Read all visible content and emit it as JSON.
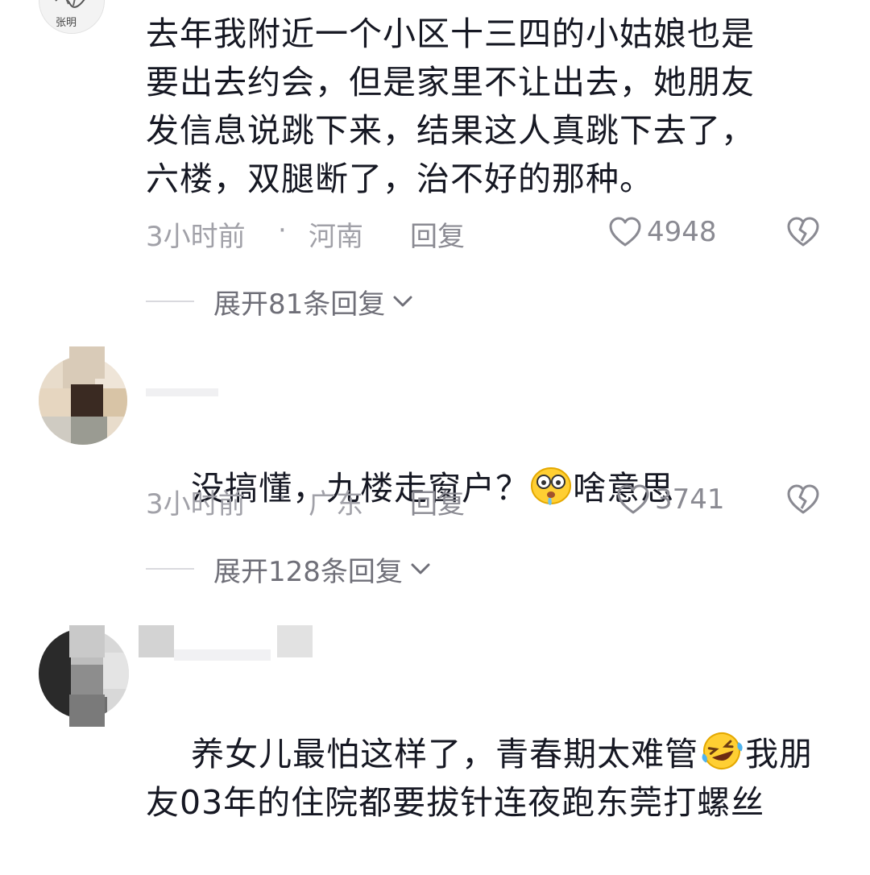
{
  "comments": [
    {
      "text": "去年我附近一个小区十三四的小姑娘也是\n要出去约会，但是家里不让出去，她朋友\n发信息说跳下来，结果这人真跳下去了，\n六楼，双腿断了，治不好的那种。",
      "time": "3小时前",
      "dot": "·",
      "location": "河南",
      "reply": "回复",
      "likes": "4948",
      "expand": "展开81条回复",
      "avatar_text": "张明"
    },
    {
      "text_before": "没搞懂，九楼走窗户？",
      "emoji": "drool-face-emoji",
      "text_after": "啥意思",
      "time": "3小时前",
      "dot": "·",
      "location": "广东",
      "reply": "回复",
      "likes": "3741",
      "expand": "展开128条回复"
    },
    {
      "text_line1_before": "养女儿最怕这样了，青春期太难管",
      "emoji": "laughing-crying-face-emoji",
      "text_line1_after": "我朋",
      "text_line2": "友03年的住院都要拔针连夜跑东莞打螺丝"
    }
  ],
  "icons": {
    "like": "heart-outline-icon",
    "dislike": "broken-heart-icon",
    "chevron": "chevron-down-icon"
  },
  "colors": {
    "text": "#161823",
    "meta": "#a1a1a8",
    "divider": "#d9d9de"
  }
}
